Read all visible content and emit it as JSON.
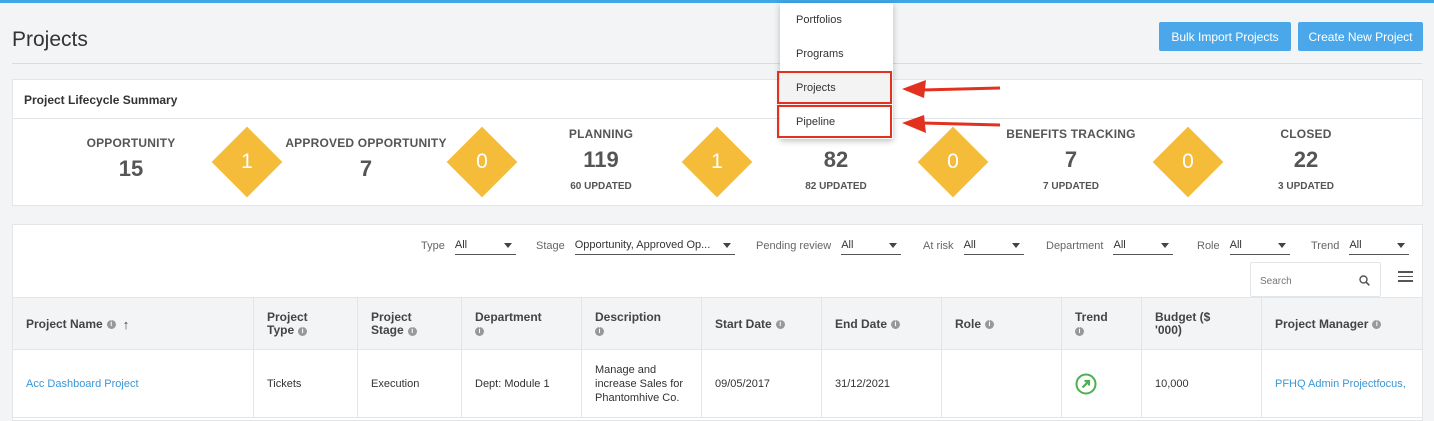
{
  "page": {
    "title": "Projects"
  },
  "buttons": {
    "bulk_import": "Bulk Import Projects",
    "create_new": "Create New Project"
  },
  "summary": {
    "title": "Project Lifecycle Summary",
    "stages": [
      {
        "label": "OPPORTUNITY",
        "count": "15",
        "updated": ""
      },
      {
        "label": "APPROVED OPPORTUNITY",
        "count": "7",
        "updated": ""
      },
      {
        "label": "PLANNING",
        "count": "119",
        "updated": "60 UPDATED"
      },
      {
        "label": "",
        "count": "82",
        "updated": "82 UPDATED"
      },
      {
        "label": "BENEFITS TRACKING",
        "count": "7",
        "updated": "7 UPDATED"
      },
      {
        "label": "CLOSED",
        "count": "22",
        "updated": "3 UPDATED"
      }
    ],
    "transitions": [
      "1",
      "0",
      "1",
      "0",
      "0"
    ]
  },
  "filters": [
    {
      "label": "Type",
      "value": "All"
    },
    {
      "label": "Stage",
      "value": "Opportunity, Approved Op..."
    },
    {
      "label": "Pending review",
      "value": "All"
    },
    {
      "label": "At risk",
      "value": "All"
    },
    {
      "label": "Department",
      "value": "All"
    },
    {
      "label": "Role",
      "value": "All"
    },
    {
      "label": "Trend",
      "value": "All"
    }
  ],
  "search": {
    "placeholder": "Search"
  },
  "table": {
    "columns": [
      "Project Name",
      "Project Type",
      "Project Stage",
      "Department",
      "Description",
      "Start Date",
      "End Date",
      "Role",
      "Trend",
      "Budget ($ '000)",
      "Project Manager"
    ],
    "rows": [
      {
        "name": "Acc Dashboard Project",
        "type": "Tickets",
        "stage": "Execution",
        "department": "Dept: Module 1",
        "description": "Manage and increase Sales for Phantomhive Co.",
        "start": "09/05/2017",
        "end": "31/12/2021",
        "role": "",
        "budget": "10,000",
        "manager": "PFHQ Admin Projectfocus,"
      }
    ]
  },
  "dropdown": {
    "items": [
      "Portfolios",
      "Programs",
      "Projects",
      "Pipeline"
    ]
  },
  "colors": {
    "accent": "#4aa8ea",
    "diamond": "#f5bc3a",
    "highlight": "#e2321f",
    "trend": "#4caf50"
  }
}
